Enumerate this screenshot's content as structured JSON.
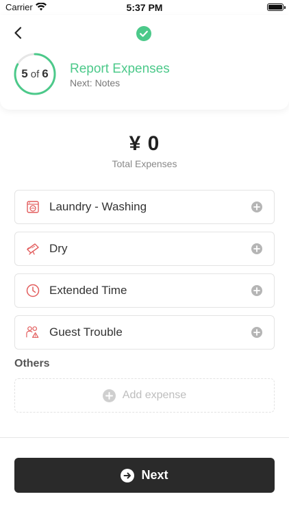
{
  "status_bar": {
    "carrier": "Carrier",
    "time": "5:37 PM"
  },
  "header": {
    "progress": {
      "current": "5",
      "of": "of",
      "total": "6",
      "fraction": 0.83
    },
    "title": "Report Expenses",
    "next_step": "Next: Notes",
    "accent_color": "#4cc98a"
  },
  "total": {
    "amount": "¥ 0",
    "label": "Total Expenses"
  },
  "expenses": [
    {
      "label": "Laundry - Washing",
      "icon": "washing-machine-icon"
    },
    {
      "label": "Dry",
      "icon": "dryer-icon"
    },
    {
      "label": "Extended Time",
      "icon": "clock-icon"
    },
    {
      "label": "Guest Trouble",
      "icon": "guest-warning-icon"
    }
  ],
  "others": {
    "title": "Others",
    "add_label": "Add expense"
  },
  "next_button": {
    "label": "Next"
  },
  "colors": {
    "icon_red": "#e25c5c",
    "button_dark": "#2a2a2a"
  }
}
